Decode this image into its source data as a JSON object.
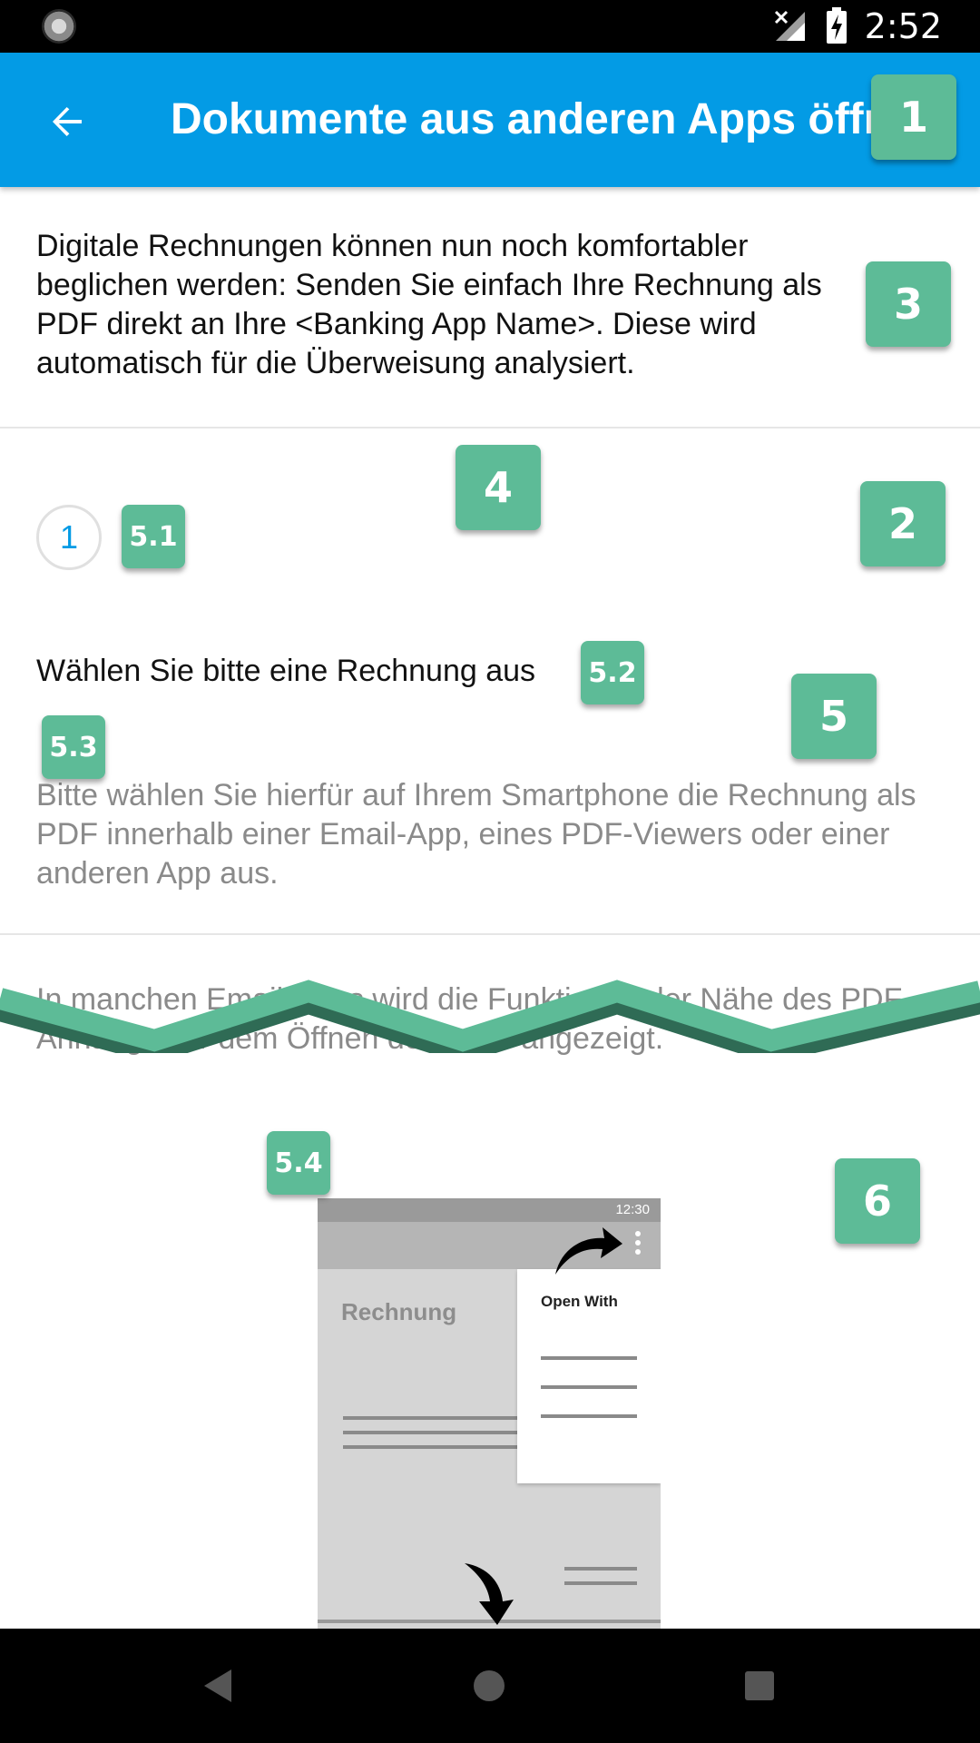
{
  "status_bar": {
    "time": "2:52"
  },
  "toolbar": {
    "title": "Dokumente aus anderen Apps öffnen"
  },
  "intro": {
    "text": "Digitale Rechnungen können nun noch komfortabler beglichen werden: Senden Sie einfach Ihre Rechnung als PDF direkt an Ihre <Banking App Name>. Diese wird automatisch für die Überweisung analysiert."
  },
  "step": {
    "number": "1",
    "title": "Wählen Sie bitte eine Rechnung aus",
    "description": "Bitte wählen Sie hierfür auf Ihrem Smartphone die Rechnung als PDF innerhalb einer Email-App, eines PDF-Viewers oder einer anderen App aus.",
    "description_continued": "In manchen Email-Apps wird die Funktion in der Nähe des PDF-Anhangs vor dem Öffnen der Datei angezeigt."
  },
  "illustration": {
    "status_time": "12:30",
    "heading": "Rechnung",
    "menu_title": "Open With"
  },
  "annotations": {
    "b1": "1",
    "b2": "2",
    "b3": "3",
    "b4": "4",
    "b5": "5",
    "b6": "6",
    "b51": "5.1",
    "b52": "5.2",
    "b53": "5.3",
    "b54": "5.4"
  },
  "icons": {
    "back": "arrow-left",
    "nav_back": "triangle-left",
    "nav_home": "circle",
    "nav_recents": "square"
  },
  "colors": {
    "toolbar": "#039be5",
    "badge": "#5dbb97",
    "step_number": "#039be5",
    "secondary_text": "#8a8a8a"
  }
}
